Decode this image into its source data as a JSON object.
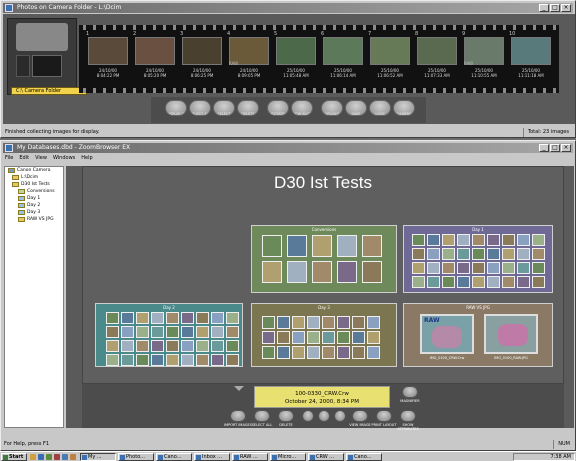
{
  "top_window": {
    "title": "Photos on Camera Folder - L:\\Dcim",
    "folder_label": "C:\\ Camera Folder",
    "status": "Finished collecting images for display.",
    "total": "Total: 23 images",
    "frames": [
      {
        "num": "1",
        "date": "24/10/00",
        "time": "8:04:22 PM",
        "raw": ""
      },
      {
        "num": "2",
        "date": "24/10/00",
        "time": "8:05:20 PM",
        "raw": ""
      },
      {
        "num": "3",
        "date": "24/10/00",
        "time": "8:06:25 PM",
        "raw": ""
      },
      {
        "num": "4",
        "date": "24/10/00",
        "time": "8:09:05 PM",
        "raw": "RAW"
      },
      {
        "num": "5",
        "date": "25/10/00",
        "time": "11:05:48 AM",
        "raw": ""
      },
      {
        "num": "6",
        "date": "25/10/00",
        "time": "11:06:14 AM",
        "raw": ""
      },
      {
        "num": "7",
        "date": "25/10/00",
        "time": "11:06:52 AM",
        "raw": ""
      },
      {
        "num": "8",
        "date": "25/10/00",
        "time": "11:07:33 AM",
        "raw": ""
      },
      {
        "num": "9",
        "date": "25/10/00",
        "time": "11:10:55 AM",
        "raw": "RAW"
      },
      {
        "num": "10",
        "date": "25/10/00",
        "time": "11:11:18 AM",
        "raw": ""
      }
    ],
    "toolbar": [
      "DISPLAY OPTIONS",
      "SELECT ALL",
      "SELECT",
      "DELETE",
      "ROTATE",
      "VIEW SLIDESHOW",
      "UPLOAD",
      "SAVE",
      "LOCK",
      "CAMERA"
    ]
  },
  "bottom_window": {
    "title": "My Databases.dbd - ZoomBrowser EX",
    "menu": [
      "File",
      "Edit",
      "View",
      "Windows",
      "Help"
    ],
    "tree": [
      "Canon Camera",
      "L:\\Dcim",
      "D30 Ist Tests",
      "Conversions",
      "Day 1",
      "Day 2",
      "Day 3",
      "RAW VS JPG"
    ],
    "db_title": "D30 Ist Tests",
    "galleries": [
      "Conversions",
      "Day 1",
      "Day 2",
      "Day 3",
      "RAW VS JPG"
    ],
    "raw_files": [
      "IMG_0100_CRW.Crw",
      "IMG_0100_RAW.JPG"
    ],
    "raw_badge": "RAW",
    "info_line1": "100-0330_CRW.Crw",
    "info_line2": "October 24, 2000, 8:34 PM",
    "controls": [
      "IMPORT IMAGES",
      "SELECT ALL",
      "DELETE",
      "",
      "",
      "",
      "VIEW IMAGE",
      "PRINT LAYOUT",
      "SHOW ATTRIBUTES"
    ],
    "magnifier": "MAGNIFIER",
    "status": "For Help, press F1",
    "num": "NUM"
  },
  "taskbar": {
    "start": "Start",
    "items": [
      "My ...",
      "Photo...",
      "Cano...",
      "Inbox ...",
      "RAW ...",
      "Micro...",
      "CRW ...",
      "Cano..."
    ],
    "clock": "7:38 AM"
  },
  "colors": {
    "title_grad_start": "#6a6a6a",
    "gallery_day1": "#6e6a95",
    "gallery_conv": "#6e8a5a",
    "gallery_day2": "#4a8a8a",
    "gallery_day3": "#7b7550",
    "gallery_raw": "#8a7a65"
  }
}
